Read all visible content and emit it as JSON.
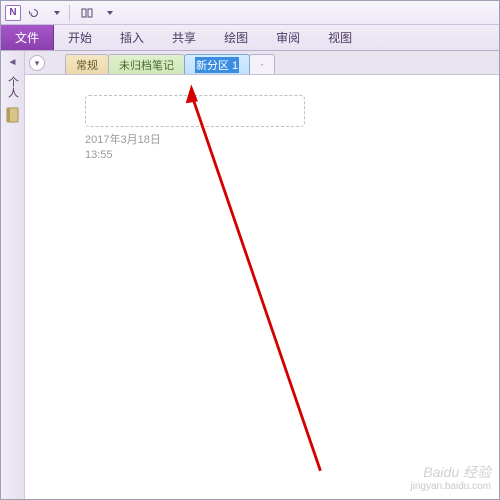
{
  "app": {
    "iconLetter": "N"
  },
  "qat": {
    "undoTip": "撤销",
    "redoTip": "重做"
  },
  "ribbon": {
    "file": "文件",
    "tabs": [
      "开始",
      "插入",
      "共享",
      "绘图",
      "审阅",
      "视图"
    ]
  },
  "sidebar": {
    "label": "个人"
  },
  "sections": {
    "regular": "常规",
    "unfiled": "未归档笔记",
    "newName": "新分区 1",
    "addTip": "+"
  },
  "page": {
    "date": "2017年3月18日",
    "time": "13:55"
  },
  "watermark": {
    "brand": "Baidu 经验",
    "url": "jingyan.baidu.com"
  }
}
